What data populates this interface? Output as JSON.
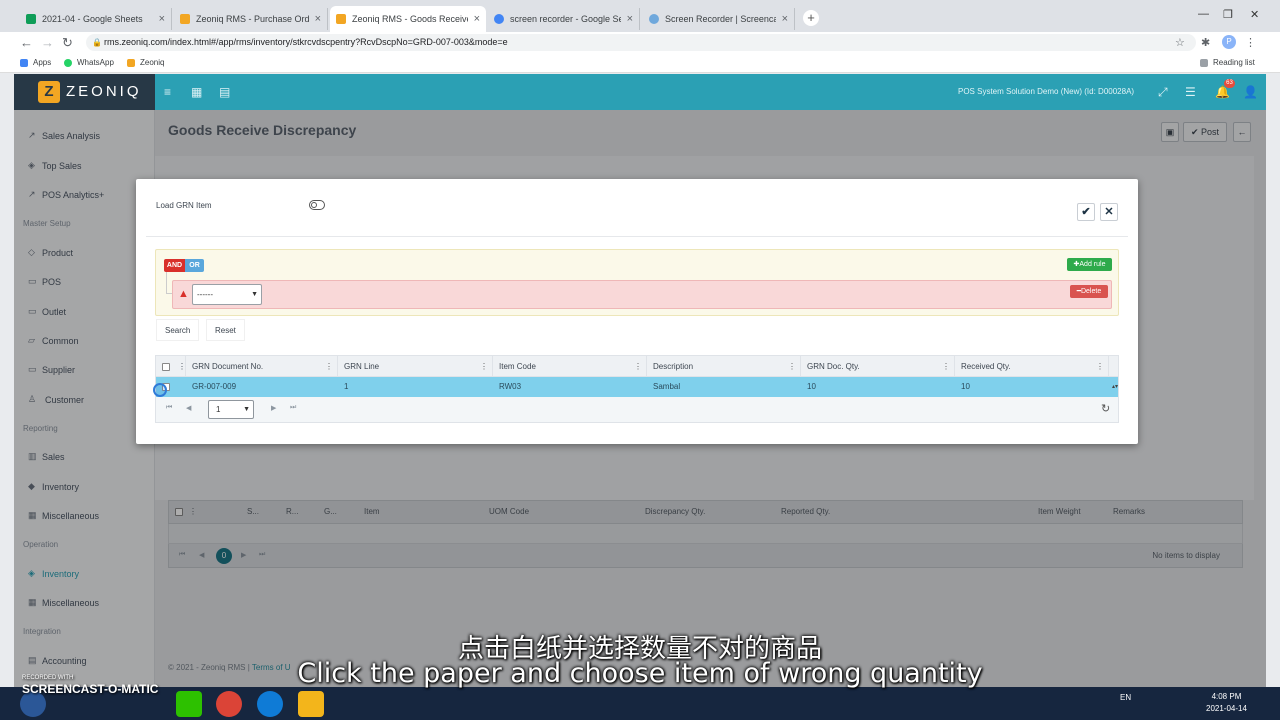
{
  "browser": {
    "tabs": [
      {
        "title": "2021-04 - Google Sheets",
        "color": "#0f9d58"
      },
      {
        "title": "Zeoniq RMS - Purchase Order En",
        "color": "#f2a623"
      },
      {
        "title": "Zeoniq RMS - Goods Receive Dis",
        "color": "#f2a623",
        "active": true
      },
      {
        "title": "screen recorder - Google Search",
        "color": "#4285f4"
      },
      {
        "title": "Screen Recorder | Screencast-O-",
        "color": "#6fa8dc"
      }
    ],
    "url": "rms.zeoniq.com/index.html#/app/rms/inventory/stkrcvdscpentry?RcvDscpNo=GRD-007-003&mode=e",
    "profile_initial": "P",
    "bookmarks": [
      "Apps",
      "WhatsApp",
      "Zeoniq"
    ],
    "reading_list": "Reading list"
  },
  "app": {
    "brand": "ZEONIQ",
    "company": "POS System Solution Demo (New) (Id: D00028A)",
    "notification_count": "63",
    "page_title": "Goods Receive Discrepancy",
    "post_label": "Post",
    "sidebar": {
      "items_top": [
        {
          "label": "Sales Analysis",
          "icon": "trend-icon"
        },
        {
          "label": "Top Sales",
          "icon": "tag-icon"
        },
        {
          "label": "POS Analytics+",
          "icon": "chart-icon"
        }
      ],
      "section_master": "Master Setup",
      "items_master": [
        {
          "label": "Product",
          "icon": "tag-icon"
        },
        {
          "label": "POS",
          "icon": "store-icon"
        },
        {
          "label": "Outlet",
          "icon": "store-icon"
        },
        {
          "label": "Common",
          "icon": "folder-icon"
        },
        {
          "label": "Supplier",
          "icon": "truck-icon"
        },
        {
          "label": "Customer",
          "icon": "user-icon"
        }
      ],
      "section_reporting": "Reporting",
      "items_reporting": [
        {
          "label": "Sales",
          "icon": "bar-chart-icon"
        },
        {
          "label": "Inventory",
          "icon": "cube-icon"
        },
        {
          "label": "Miscellaneous",
          "icon": "grid-icon"
        }
      ],
      "section_operation": "Operation",
      "items_operation": [
        {
          "label": "Inventory",
          "icon": "tags-icon",
          "active": true
        },
        {
          "label": "Miscellaneous",
          "icon": "grid-icon"
        }
      ],
      "section_integration": "Integration",
      "items_integration": [
        {
          "label": "Accounting",
          "icon": "calculator-icon"
        }
      ]
    },
    "bottom_grid": {
      "columns": [
        "S...",
        "R...",
        "G...",
        "Item",
        "UOM Code",
        "Discrepancy Qty.",
        "Reported Qty.",
        "Item Weight",
        "Remarks"
      ],
      "page": "0",
      "empty_text": "No items to display"
    },
    "footer": {
      "copyright": "© 2021 - Zeoniq RMS |",
      "link": "Terms of U"
    }
  },
  "modal": {
    "load_grn_label": "Load GRN Item",
    "query": {
      "and_label": "AND",
      "or_label": "OR",
      "add_rule_label": "Add rule",
      "delete_label": "Delete",
      "rule_value": "------"
    },
    "search_label": "Search",
    "reset_label": "Reset",
    "grid": {
      "columns": [
        "GRN Document No.",
        "GRN Line",
        "Item Code",
        "Description",
        "GRN Doc. Qty.",
        "Received Qty."
      ],
      "rows": [
        {
          "doc_no": "GR-007-009",
          "line": "1",
          "item_code": "RW03",
          "description": "Sambal",
          "doc_qty": "10",
          "received_qty": "10"
        }
      ],
      "page": "1"
    }
  },
  "subtitles": {
    "chinese": "点击白纸并选择数量不对的商品",
    "english": "Click the paper and choose item of wrong quantity"
  },
  "watermark": {
    "small": "RECORDED WITH",
    "brand": "SCREENCAST-O-MATIC"
  },
  "taskbar": {
    "lang": "EN",
    "time": "4:08 PM",
    "date": "2021-04-14"
  },
  "colors": {
    "accent": "#2ba0b4",
    "selected_row": "#7fd0ec",
    "and_red": "#d9302b",
    "add_green": "#2eaa4b"
  }
}
